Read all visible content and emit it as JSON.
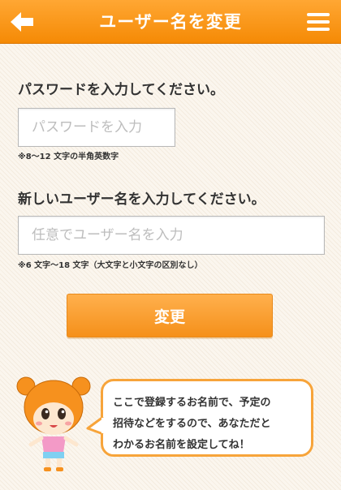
{
  "header": {
    "title": "ユーザー名を変更"
  },
  "form": {
    "password_label": "パスワードを入力してください。",
    "password_placeholder": "パスワードを入力",
    "password_hint": "※8〜12 文字の半角英数字",
    "username_label": "新しいユーザー名を入力してください。",
    "username_placeholder": "任意でユーザー名を入力",
    "username_hint": "※6 文字〜18 文字（大文字と小文字の区別なし）",
    "submit_label": "変更"
  },
  "speech_bubble": {
    "lines": [
      "ここで登録するお名前で、予定の",
      "招待などをするので、あなただと",
      "わかるお名前を設定してね！"
    ]
  },
  "colors": {
    "accent": "#f7931e",
    "bubble_border": "#f7a43a"
  },
  "icons": {
    "back": "back-arrow-icon",
    "menu": "hamburger-menu-icon"
  }
}
